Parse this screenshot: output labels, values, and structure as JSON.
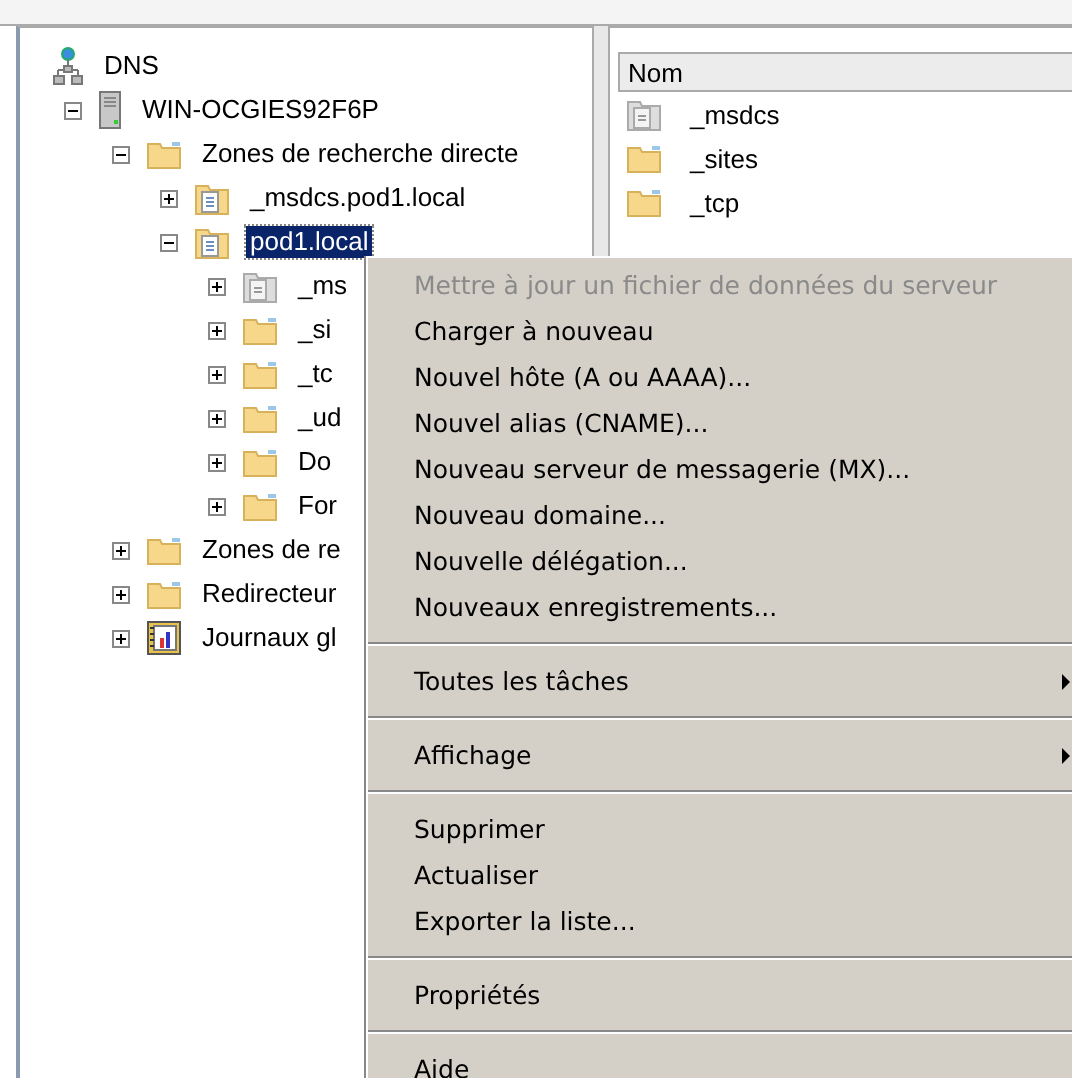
{
  "tree": [
    {
      "label": "DNS",
      "kind": "dns",
      "selected": false,
      "children": [
        {
          "label": "WIN-OCGIES92F6P",
          "kind": "server",
          "expanded": true,
          "selected": false,
          "children": [
            {
              "label": "Zones de recherche directe",
              "kind": "folder",
              "expanded": true,
              "selected": false,
              "children": [
                {
                  "label": "_msdcs.pod1.local",
                  "kind": "zone",
                  "expanded": false,
                  "selected": false
                },
                {
                  "label": "pod1.local",
                  "kind": "zone",
                  "expanded": true,
                  "selected": true,
                  "children": [
                    {
                      "label": "_ms",
                      "kind": "zone-grey",
                      "expanded": false,
                      "selected": false
                    },
                    {
                      "label": "_si",
                      "kind": "folder",
                      "expanded": false,
                      "selected": false
                    },
                    {
                      "label": "_tc",
                      "kind": "folder",
                      "expanded": false,
                      "selected": false
                    },
                    {
                      "label": "_ud",
                      "kind": "folder",
                      "expanded": false,
                      "selected": false
                    },
                    {
                      "label": "Do",
                      "kind": "folder",
                      "expanded": false,
                      "selected": false
                    },
                    {
                      "label": "For",
                      "kind": "folder",
                      "expanded": false,
                      "selected": false
                    }
                  ]
                }
              ]
            },
            {
              "label": "Zones de re",
              "kind": "folder",
              "expanded": false,
              "selected": false
            },
            {
              "label": "Redirecteur",
              "kind": "folder",
              "expanded": false,
              "selected": false
            },
            {
              "label": "Journaux gl",
              "kind": "log",
              "expanded": false,
              "selected": false
            }
          ]
        }
      ]
    }
  ],
  "list": {
    "column": "Nom",
    "items": [
      {
        "label": "_msdcs",
        "kind": "zone-grey"
      },
      {
        "label": "_sites",
        "kind": "folder"
      },
      {
        "label": "_tcp",
        "kind": "folder"
      }
    ]
  },
  "context_menu": [
    {
      "kind": "item",
      "label": "Mettre à jour un fichier de données du serveur",
      "disabled": true,
      "submenu": false
    },
    {
      "kind": "item",
      "label": "Charger à nouveau",
      "disabled": false,
      "submenu": false
    },
    {
      "kind": "item",
      "label": "Nouvel hôte (A ou AAAA)...",
      "disabled": false,
      "submenu": false
    },
    {
      "kind": "item",
      "label": "Nouvel alias (CNAME)...",
      "disabled": false,
      "submenu": false
    },
    {
      "kind": "item",
      "label": "Nouveau serveur de messagerie (MX)...",
      "disabled": false,
      "submenu": false
    },
    {
      "kind": "item",
      "label": "Nouveau domaine...",
      "disabled": false,
      "submenu": false
    },
    {
      "kind": "item",
      "label": "Nouvelle délégation...",
      "disabled": false,
      "submenu": false
    },
    {
      "kind": "item",
      "label": "Nouveaux enregistrements...",
      "disabled": false,
      "submenu": false
    },
    {
      "kind": "separator"
    },
    {
      "kind": "item",
      "label": "Toutes les tâches",
      "disabled": false,
      "submenu": true
    },
    {
      "kind": "separator"
    },
    {
      "kind": "item",
      "label": "Affichage",
      "disabled": false,
      "submenu": true
    },
    {
      "kind": "separator"
    },
    {
      "kind": "item",
      "label": "Supprimer",
      "disabled": false,
      "submenu": false
    },
    {
      "kind": "item",
      "label": "Actualiser",
      "disabled": false,
      "submenu": false
    },
    {
      "kind": "item",
      "label": "Exporter la liste...",
      "disabled": false,
      "submenu": false
    },
    {
      "kind": "separator"
    },
    {
      "kind": "item",
      "label": "Propriétés",
      "disabled": false,
      "submenu": false
    },
    {
      "kind": "separator"
    },
    {
      "kind": "item",
      "label": "Aide",
      "disabled": false,
      "submenu": false
    }
  ]
}
